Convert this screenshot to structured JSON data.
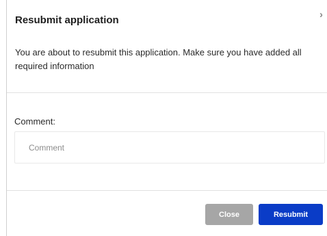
{
  "dialog": {
    "title": "Resubmit application",
    "message": "You are about to resubmit this application. Make sure you have added all required information",
    "close_icon": "close-icon"
  },
  "comment": {
    "label": "Comment:",
    "placeholder": "Comment",
    "value": ""
  },
  "buttons": {
    "close_label": "Close",
    "resubmit_label": "Resubmit"
  },
  "colors": {
    "primary": "#0a3cc7",
    "secondary": "#a6a6a6"
  }
}
